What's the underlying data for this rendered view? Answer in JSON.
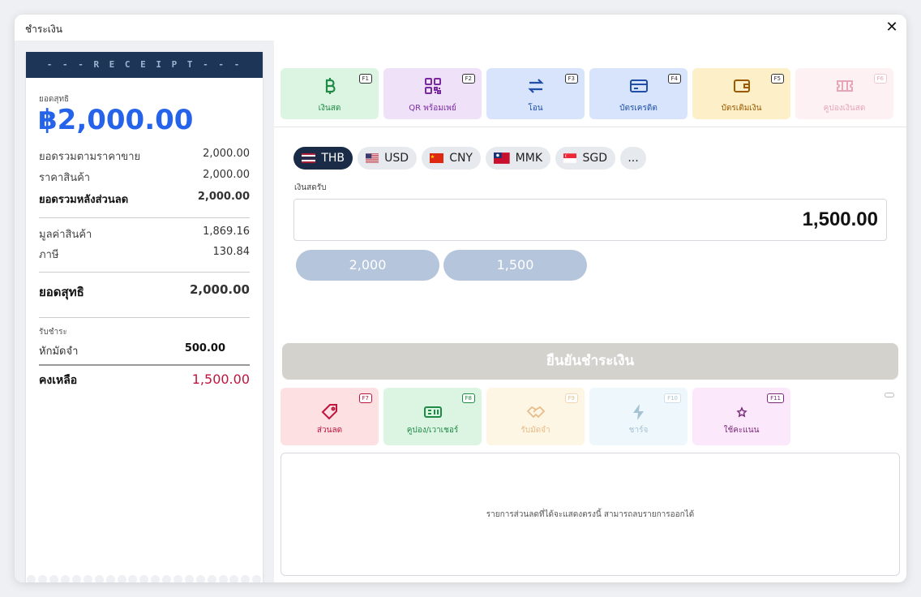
{
  "modal": {
    "title": "ชำระเงิน",
    "close": "✕"
  },
  "receipt": {
    "header": "- - -  R E C E I P T  - - -",
    "net_label": "ยอดสุทธิ",
    "net_amount": "฿2,000.00",
    "rows": [
      {
        "label": "ยอดรวมตามราคาขาย",
        "value": "2,000.00"
      },
      {
        "label": "ราคาสินค้า",
        "value": "2,000.00"
      },
      {
        "label": "ยอดรวมหลังส่วนลด",
        "value": "2,000.00"
      },
      {
        "label": "มูลค่าสินค้า",
        "value": "1,869.16"
      },
      {
        "label": "ภาษี",
        "value": "130.84"
      },
      {
        "label": "ยอดสุทธิ",
        "value": "2,000.00"
      }
    ],
    "pay_label": "รับชำระ",
    "deposit": {
      "label": "หักมัดจำ",
      "value": "500.00"
    },
    "remain": {
      "label": "คงเหลือ",
      "value": "1,500.00"
    }
  },
  "payment_methods": [
    {
      "label": "เงินสด",
      "key": "F1",
      "bg": "#dcf5e3",
      "color": "#1f8a45"
    },
    {
      "label": "QR พร้อมเพย์",
      "key": "F2",
      "bg": "#efe1f8",
      "color": "#7a2aa0"
    },
    {
      "label": "โอน",
      "key": "F3",
      "bg": "#d7e4fb",
      "color": "#1f4fa8"
    },
    {
      "label": "บัตรเครดิต",
      "key": "F4",
      "bg": "#d7e4fb",
      "color": "#1f4fa8"
    },
    {
      "label": "บัตรเติมเงิน",
      "key": "F5",
      "bg": "#fdf0c8",
      "color": "#9a5a00"
    },
    {
      "label": "คูปองเงินสด",
      "key": "F6",
      "bg": "#fdf1f4",
      "color": "#e6a6b6"
    }
  ],
  "currencies": [
    {
      "code": "THB",
      "active": true
    },
    {
      "code": "USD",
      "active": false
    },
    {
      "code": "CNY",
      "active": false
    },
    {
      "code": "MMK",
      "active": false
    },
    {
      "code": "SGD",
      "active": false
    },
    {
      "code": "...",
      "active": false
    }
  ],
  "cash": {
    "label": "เงินสดรับ",
    "value": "1,500.00"
  },
  "quick_amounts": [
    "2,000",
    "1,500"
  ],
  "confirm_label": "ยืนยันชำระเงิน",
  "actions": [
    {
      "label": "ส่วนลด",
      "key": "F7",
      "bg": "#fde0e2",
      "color": "#c0143c"
    },
    {
      "label": "คูปอง/เวาเชอร์",
      "key": "F8",
      "bg": "#dcf5e3",
      "color": "#1f8a45"
    },
    {
      "label": "รับมัดจำ",
      "key": "F9",
      "bg": "#fef6e4",
      "color": "#e6bd8a"
    },
    {
      "label": "ชาร์จ",
      "key": "F10",
      "bg": "#eef7fb",
      "color": "#a5c3d3"
    },
    {
      "label": "ใช้คะแนน",
      "key": "F11",
      "bg": "#fbe9fb",
      "color": "#7a2a7a"
    }
  ],
  "discount_message": "รายการส่วนลดที่ได้จะแสดงตรงนี้ สามารถลบรายการออกได้"
}
